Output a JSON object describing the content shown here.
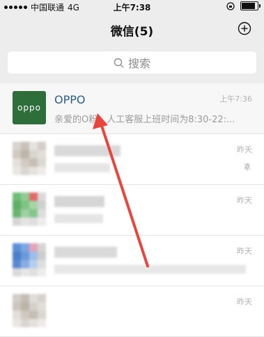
{
  "status_bar": {
    "carrier": "中国联通",
    "network": "4G",
    "time": "上午7:38",
    "battery_level": 0.85
  },
  "nav": {
    "title": "微信(5)",
    "add_icon": "plus-circle-icon"
  },
  "search": {
    "placeholder": "搜索",
    "icon": "search-icon"
  },
  "chats": [
    {
      "name": "OPPO",
      "avatar_text": "oppo",
      "time": "上午7:36",
      "preview": "亲爱的O粉，人工客服上班时间为8:30-22:..."
    },
    {
      "time": "昨天",
      "muted": true
    },
    {
      "time": "昨天"
    },
    {
      "time": "昨天"
    },
    {
      "time": "昨天"
    }
  ],
  "colors": {
    "oppo_green": "#2d6e3b",
    "annotation_red": "#e8453c",
    "name_blue": "#2a5e8c"
  }
}
